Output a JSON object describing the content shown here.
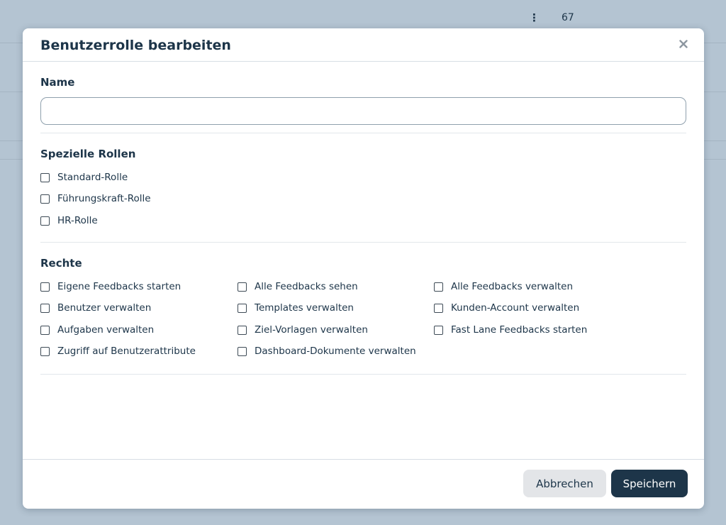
{
  "background": {
    "kebab_glyph": "⋮",
    "count": "67"
  },
  "modal": {
    "title": "Benutzerrolle bearbeiten",
    "close_glyph": "×",
    "name_section": {
      "label": "Name",
      "value": "",
      "placeholder": ""
    },
    "special_roles": {
      "title": "Spezielle Rollen",
      "items": [
        {
          "label": "Standard-Rolle",
          "checked": false
        },
        {
          "label": "Führungskraft-Rolle",
          "checked": false
        },
        {
          "label": "HR-Rolle",
          "checked": false
        }
      ]
    },
    "rights": {
      "title": "Rechte",
      "items": [
        {
          "label": "Eigene Feedbacks starten",
          "checked": false
        },
        {
          "label": "Alle Feedbacks sehen",
          "checked": false
        },
        {
          "label": "Alle Feedbacks verwalten",
          "checked": false
        },
        {
          "label": "Benutzer verwalten",
          "checked": false
        },
        {
          "label": "Templates verwalten",
          "checked": false
        },
        {
          "label": "Kunden-Account verwalten",
          "checked": false
        },
        {
          "label": "Aufgaben verwalten",
          "checked": false
        },
        {
          "label": "Ziel-Vorlagen verwalten",
          "checked": false
        },
        {
          "label": "Fast Lane Feedbacks starten",
          "checked": false
        },
        {
          "label": "Zugriff auf Benutzerattribute",
          "checked": false
        },
        {
          "label": "Dashboard-Dokumente verwalten",
          "checked": false
        }
      ]
    },
    "footer": {
      "cancel_label": "Abbrechen",
      "save_label": "Speichern"
    }
  },
  "colors": {
    "primary": "#1d3549",
    "backdrop": "#b4c4d2",
    "cancel_bg": "#e3e5e8"
  }
}
